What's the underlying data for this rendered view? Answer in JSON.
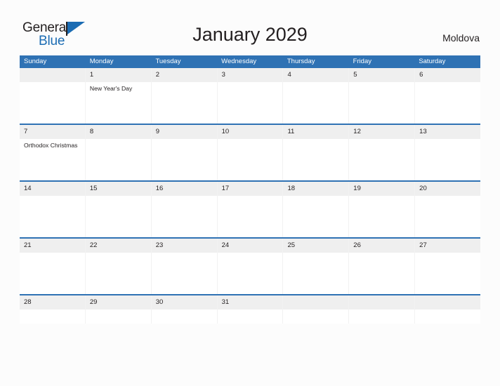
{
  "brand": {
    "name_part1": "General",
    "name_part2": "Blue",
    "flag_icon": "blue-flag-triangle-icon",
    "color_dark": "#231f20",
    "color_blue": "#1b6cb3"
  },
  "header": {
    "title": "January 2029",
    "country": "Moldova"
  },
  "theme": {
    "header_blue": "#2f72b4",
    "row_band_gray": "#efefef",
    "page_background": "#fcfcfc",
    "text_color": "#231f20"
  },
  "calendar": {
    "month": "January",
    "year": "2029",
    "weekday_headers": [
      "Sunday",
      "Monday",
      "Tuesday",
      "Wednesday",
      "Thursday",
      "Friday",
      "Saturday"
    ],
    "weeks": [
      {
        "days": [
          {
            "number": "",
            "events": []
          },
          {
            "number": "1",
            "events": [
              "New Year's Day"
            ]
          },
          {
            "number": "2",
            "events": []
          },
          {
            "number": "3",
            "events": []
          },
          {
            "number": "4",
            "events": []
          },
          {
            "number": "5",
            "events": []
          },
          {
            "number": "6",
            "events": []
          }
        ]
      },
      {
        "days": [
          {
            "number": "7",
            "events": [
              "Orthodox Christmas"
            ]
          },
          {
            "number": "8",
            "events": []
          },
          {
            "number": "9",
            "events": []
          },
          {
            "number": "10",
            "events": []
          },
          {
            "number": "11",
            "events": []
          },
          {
            "number": "12",
            "events": []
          },
          {
            "number": "13",
            "events": []
          }
        ]
      },
      {
        "days": [
          {
            "number": "14",
            "events": []
          },
          {
            "number": "15",
            "events": []
          },
          {
            "number": "16",
            "events": []
          },
          {
            "number": "17",
            "events": []
          },
          {
            "number": "18",
            "events": []
          },
          {
            "number": "19",
            "events": []
          },
          {
            "number": "20",
            "events": []
          }
        ]
      },
      {
        "days": [
          {
            "number": "21",
            "events": []
          },
          {
            "number": "22",
            "events": []
          },
          {
            "number": "23",
            "events": []
          },
          {
            "number": "24",
            "events": []
          },
          {
            "number": "25",
            "events": []
          },
          {
            "number": "26",
            "events": []
          },
          {
            "number": "27",
            "events": []
          }
        ]
      },
      {
        "days": [
          {
            "number": "28",
            "events": []
          },
          {
            "number": "29",
            "events": []
          },
          {
            "number": "30",
            "events": []
          },
          {
            "number": "31",
            "events": []
          },
          {
            "number": "",
            "events": []
          },
          {
            "number": "",
            "events": []
          },
          {
            "number": "",
            "events": []
          }
        ]
      }
    ]
  }
}
